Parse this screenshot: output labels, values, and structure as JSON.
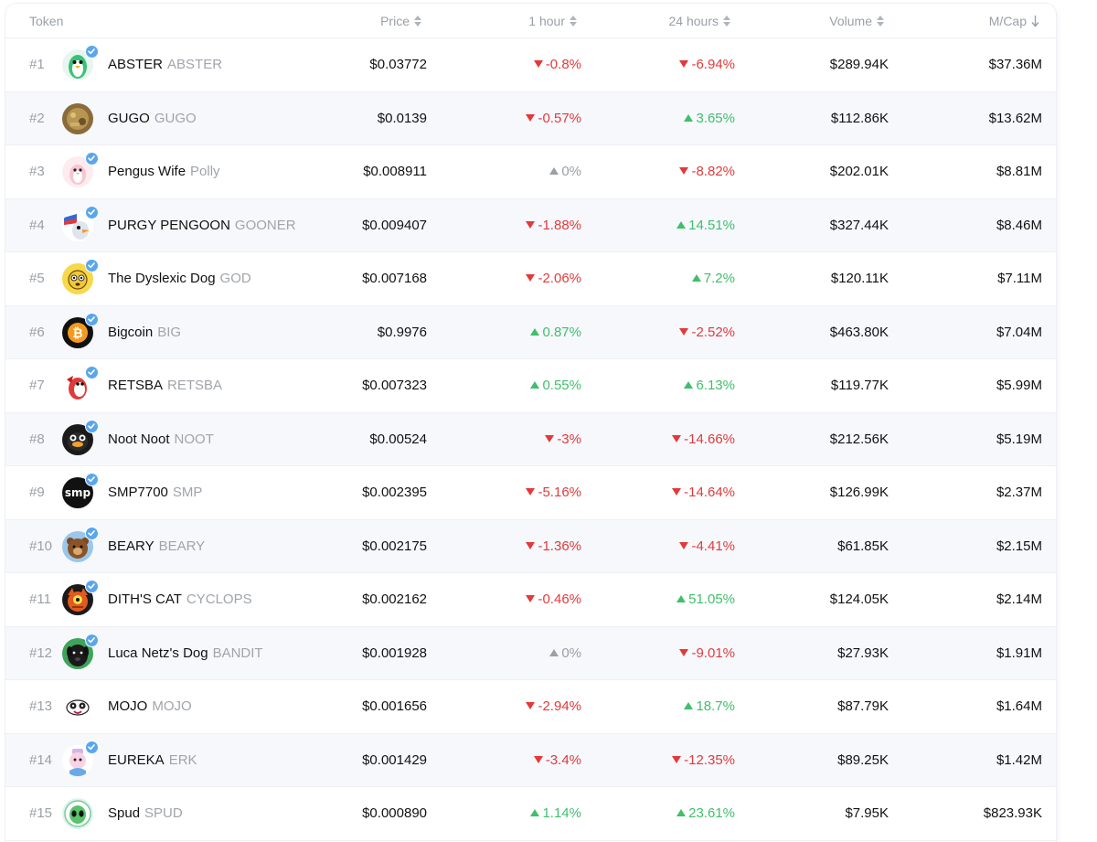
{
  "header": {
    "token": "Token",
    "price": "Price",
    "hour1": "1 hour",
    "hours24": "24 hours",
    "volume": "Volume",
    "mcap": "M/Cap"
  },
  "colors": {
    "up": "#3fbf6b",
    "down": "#e23a3a",
    "flat": "#9aa0a8",
    "verified": "#5aa6ec"
  },
  "rows": [
    {
      "rank": "#1",
      "name": "ABSTER",
      "symbol": "ABSTER",
      "verified": true,
      "avatar_icon": "green-penguin-icon",
      "price": "$0.03772",
      "h1": "-0.8%",
      "h1_dir": "down",
      "h24": "-6.94%",
      "h24_dir": "down",
      "volume": "$289.94K",
      "mcap": "$37.36M"
    },
    {
      "rank": "#2",
      "name": "GUGO",
      "symbol": "GUGO",
      "verified": false,
      "avatar_icon": "painted-portrait-icon",
      "price": "$0.0139",
      "h1": "-0.57%",
      "h1_dir": "down",
      "h24": "3.65%",
      "h24_dir": "up",
      "volume": "$112.86K",
      "mcap": "$13.62M"
    },
    {
      "rank": "#3",
      "name": "Pengus Wife",
      "symbol": "Polly",
      "verified": true,
      "avatar_icon": "pink-penguin-icon",
      "price": "$0.008911",
      "h1": "0%",
      "h1_dir": "flat",
      "h24": "-8.82%",
      "h24_dir": "down",
      "volume": "$202.01K",
      "mcap": "$8.81M"
    },
    {
      "rank": "#4",
      "name": "PURGY PENGOON",
      "symbol": "GOONER",
      "verified": true,
      "avatar_icon": "penguin-flag-icon",
      "price": "$0.009407",
      "h1": "-1.88%",
      "h1_dir": "down",
      "h24": "14.51%",
      "h24_dir": "up",
      "volume": "$327.44K",
      "mcap": "$8.46M"
    },
    {
      "rank": "#5",
      "name": "The Dyslexic Dog",
      "symbol": "GOD",
      "verified": true,
      "avatar_icon": "yellow-dog-icon",
      "price": "$0.007168",
      "h1": "-2.06%",
      "h1_dir": "down",
      "h24": "7.2%",
      "h24_dir": "up",
      "volume": "$120.11K",
      "mcap": "$7.11M"
    },
    {
      "rank": "#6",
      "name": "Bigcoin",
      "symbol": "BIG",
      "verified": true,
      "avatar_icon": "bitcoin-icon",
      "price": "$0.9976",
      "h1": "0.87%",
      "h1_dir": "up",
      "h24": "-2.52%",
      "h24_dir": "down",
      "volume": "$463.80K",
      "mcap": "$7.04M"
    },
    {
      "rank": "#7",
      "name": "RETSBA",
      "symbol": "RETSBA",
      "verified": true,
      "avatar_icon": "red-penguin-icon",
      "price": "$0.007323",
      "h1": "0.55%",
      "h1_dir": "up",
      "h24": "6.13%",
      "h24_dir": "up",
      "volume": "$119.77K",
      "mcap": "$5.99M"
    },
    {
      "rank": "#8",
      "name": "Noot Noot",
      "symbol": "NOOT",
      "verified": true,
      "avatar_icon": "black-penguin-icon",
      "price": "$0.00524",
      "h1": "-3%",
      "h1_dir": "down",
      "h24": "-14.66%",
      "h24_dir": "down",
      "volume": "$212.56K",
      "mcap": "$5.19M"
    },
    {
      "rank": "#9",
      "name": "SMP7700",
      "symbol": "SMP",
      "verified": true,
      "avatar_icon": "smp-logo-icon",
      "avatar_text": "smp",
      "price": "$0.002395",
      "h1": "-5.16%",
      "h1_dir": "down",
      "h24": "-14.64%",
      "h24_dir": "down",
      "volume": "$126.99K",
      "mcap": "$2.37M"
    },
    {
      "rank": "#10",
      "name": "BEARY",
      "symbol": "BEARY",
      "verified": true,
      "avatar_icon": "bear-icon",
      "price": "$0.002175",
      "h1": "-1.36%",
      "h1_dir": "down",
      "h24": "-4.41%",
      "h24_dir": "down",
      "volume": "$61.85K",
      "mcap": "$2.15M"
    },
    {
      "rank": "#11",
      "name": "DITH'S CAT",
      "symbol": "CYCLOPS",
      "verified": true,
      "avatar_icon": "cyclops-cat-icon",
      "price": "$0.002162",
      "h1": "-0.46%",
      "h1_dir": "down",
      "h24": "51.05%",
      "h24_dir": "up",
      "volume": "$124.05K",
      "mcap": "$2.14M"
    },
    {
      "rank": "#12",
      "name": "Luca Netz's Dog",
      "symbol": "BANDIT",
      "verified": true,
      "avatar_icon": "black-dog-icon",
      "price": "$0.001928",
      "h1": "0%",
      "h1_dir": "flat",
      "h24": "-9.01%",
      "h24_dir": "down",
      "volume": "$27.93K",
      "mcap": "$1.91M"
    },
    {
      "rank": "#13",
      "name": "MOJO",
      "symbol": "MOJO",
      "verified": false,
      "avatar_icon": "mojo-face-icon",
      "price": "$0.001656",
      "h1": "-2.94%",
      "h1_dir": "down",
      "h24": "18.7%",
      "h24_dir": "up",
      "volume": "$87.79K",
      "mcap": "$1.64M"
    },
    {
      "rank": "#14",
      "name": "EUREKA",
      "symbol": "ERK",
      "verified": true,
      "avatar_icon": "pink-character-icon",
      "price": "$0.001429",
      "h1": "-3.4%",
      "h1_dir": "down",
      "h24": "-12.35%",
      "h24_dir": "down",
      "volume": "$89.25K",
      "mcap": "$1.42M"
    },
    {
      "rank": "#15",
      "name": "Spud",
      "symbol": "SPUD",
      "verified": false,
      "avatar_icon": "green-alien-icon",
      "price": "$0.000890",
      "h1": "1.14%",
      "h1_dir": "up",
      "h24": "23.61%",
      "h24_dir": "up",
      "volume": "$7.95K",
      "mcap": "$823.93K"
    }
  ]
}
